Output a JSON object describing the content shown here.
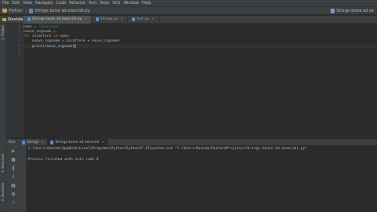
{
  "menu": [
    "File",
    "Edit",
    "View",
    "Navigate",
    "Code",
    "Refactor",
    "Run",
    "Tools",
    "VCS",
    "Window",
    "Help"
  ],
  "breadcrumb": {
    "project": "Python",
    "file": "Strings konie ad execcidi.py"
  },
  "run_config": "Strings konie ad ex",
  "project_tool": "Davide",
  "tabs": [
    {
      "label": "Strings konie ad execcidi.py",
      "active": true
    },
    {
      "label": "Strings.py",
      "active": false
    },
    {
      "label": "test.py",
      "active": false
    }
  ],
  "line_numbers": [
    "1",
    "2",
    "3",
    "4",
    "5",
    "6",
    "7"
  ],
  "code": [
    {
      "tokens": [
        {
          "t": "nome = ",
          "c": "var"
        },
        {
          "t": "'Giacinoo'",
          "c": "str"
        }
      ]
    },
    {
      "tokens": [
        {
          "t": "nuovo_cognome = ",
          "c": "var"
        }
      ]
    },
    {
      "tokens": [
        {
          "t": "for ",
          "c": "kw"
        },
        {
          "t": "carattere ",
          "c": "var"
        },
        {
          "t": "in ",
          "c": "kw"
        },
        {
          "t": "nome:",
          "c": "var"
        }
      ]
    },
    {
      "tokens": [
        {
          "t": "    nuovo_cognome = carattere + nuovo_cognome",
          "c": "var"
        }
      ]
    },
    {
      "tokens": [
        {
          "t": "    print(nuovo_cognome)",
          "c": "var"
        }
      ],
      "current": true
    },
    {
      "tokens": []
    },
    {
      "tokens": []
    }
  ],
  "run_panel": {
    "label": "Run",
    "tabs": [
      {
        "label": "Strings",
        "active": false
      },
      {
        "label": "Strings konie ad execcidi",
        "active": true
      }
    ]
  },
  "left_tabs": {
    "project": "1: Project",
    "structure": "2: Structure",
    "favorites": "2: Favorites"
  },
  "console": {
    "command": "C:\\Users\\Davide\\AppData\\Local\\Programs\\Python\\Python37-32\\python.exe \"C:/Users/Davide/PycharmProjects/Strings konie ad execcidi.py\"",
    "exit": "Process finished with exit code 0"
  }
}
